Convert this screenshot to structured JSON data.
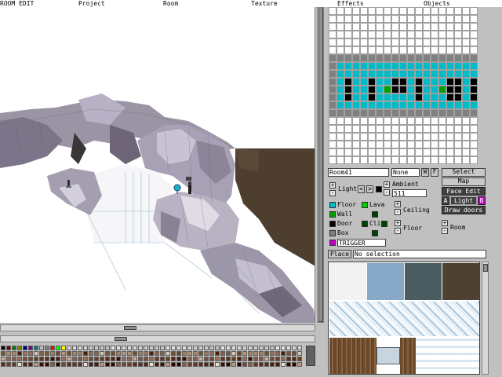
{
  "menu": {
    "room_edit": "ROOM EDIT",
    "project": "Project",
    "room": "Room",
    "texture": "Texture",
    "effects": "Effects",
    "objects": "Objects"
  },
  "colors": {
    "floor": "#00bcc8",
    "wall": "#00a000",
    "door": "#000000",
    "box": "#808080",
    "trigger": "#c000c0",
    "lava": "#00d000",
    "grid_line": "#a0a0a0"
  },
  "room_panel": {
    "room_name": "Room41",
    "alt_room": "None",
    "w_label": "W",
    "f_label": "F",
    "light_label": "Light",
    "ambient_label": "Ambient",
    "ambient_value": "511",
    "ceiling_label": "Ceiling",
    "floor_height_label": "Floor",
    "room_label": "Room",
    "select_button": "Select",
    "map_button": "Map",
    "face_edit_button": "Face Edit",
    "light_a": "A",
    "light_button": "Light",
    "light_b": "B",
    "draw_doors_button": "Draw doors",
    "plus": "+",
    "minus": "-",
    "prev": "<",
    "next": ">"
  },
  "sectors": {
    "floor": "Floor",
    "lava": "Lava",
    "wall": "Wall",
    "cli": "Cli",
    "door": "Door",
    "box": "Box",
    "trigger": "TRIGGER"
  },
  "place": {
    "button": "Place",
    "selection": "No selection"
  },
  "icons": {
    "light_bulb": "light-bulb-icon",
    "object_figure": "lara-figure-icon"
  }
}
